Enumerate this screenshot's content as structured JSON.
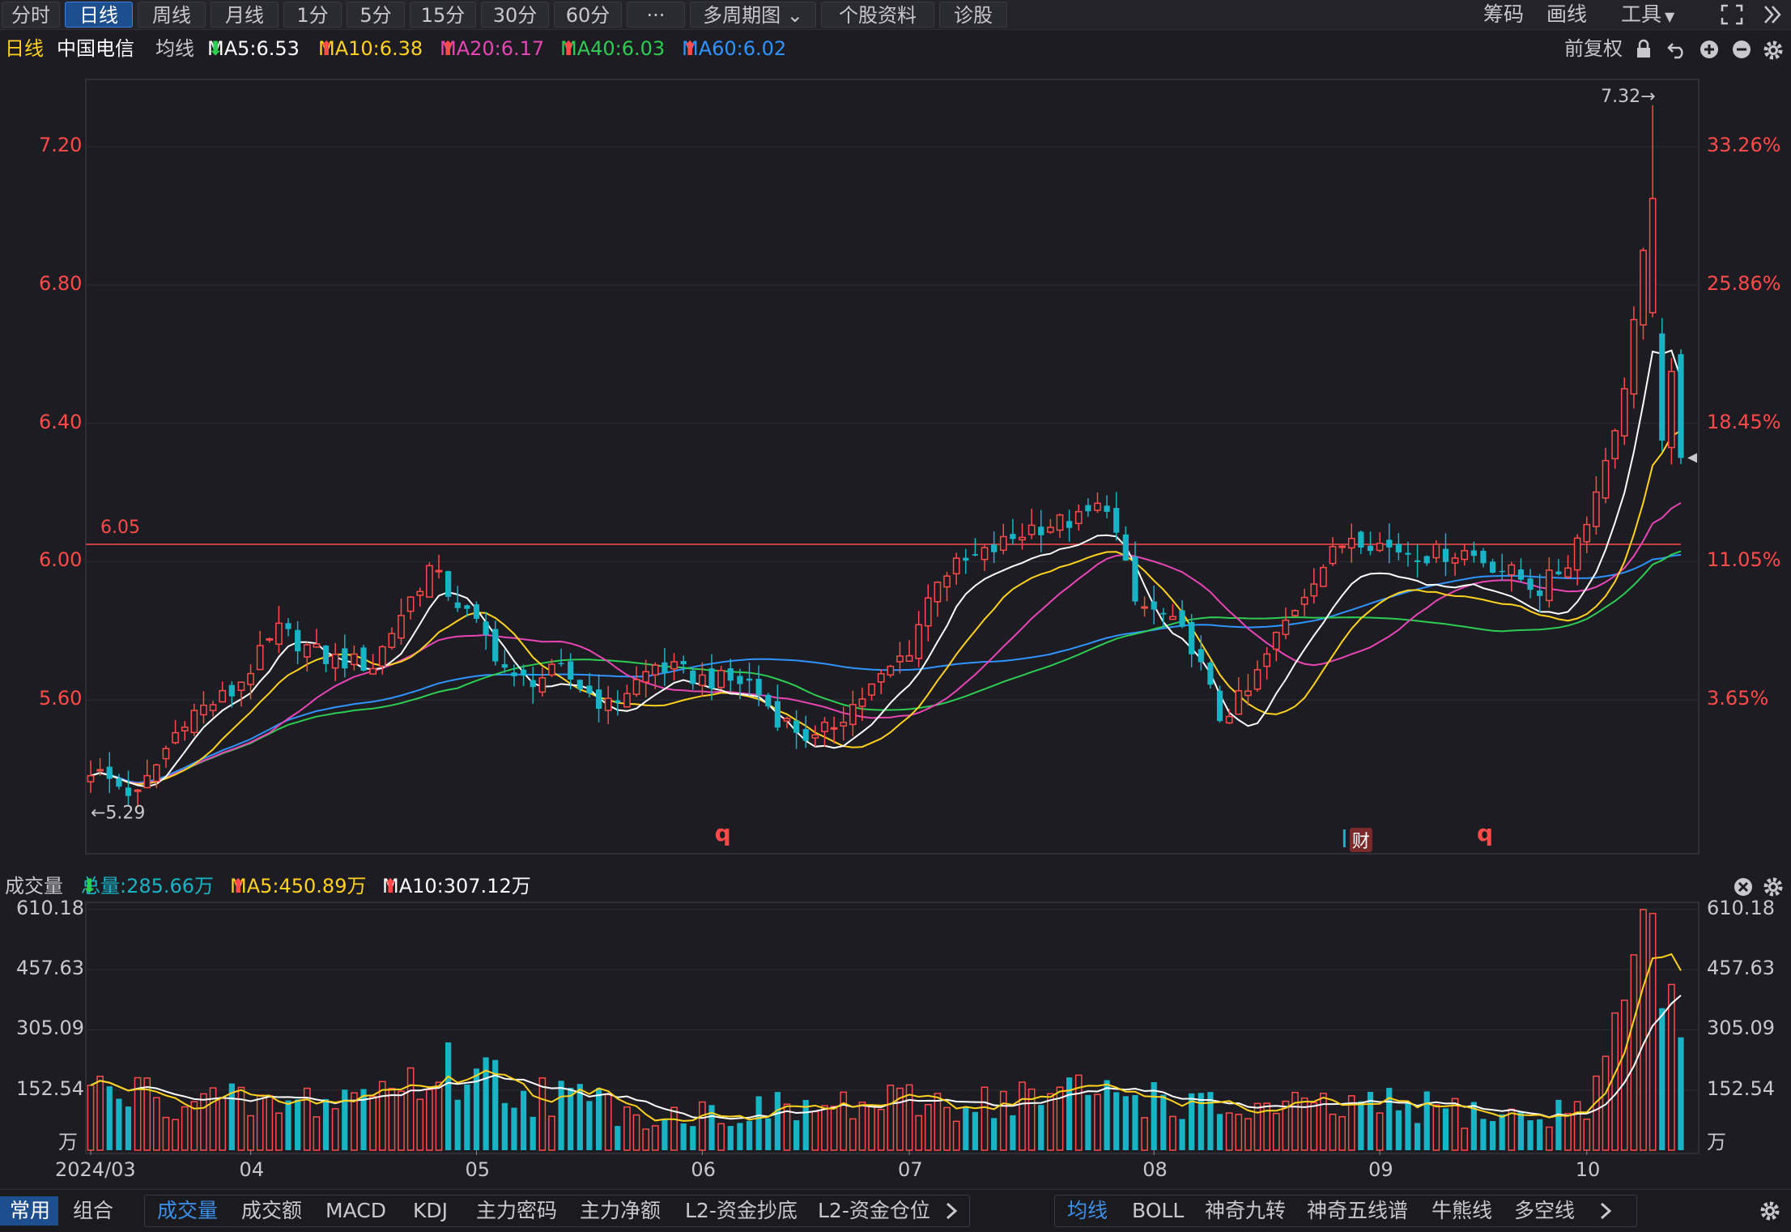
{
  "toolbar": {
    "tabs": [
      "分时",
      "日线",
      "周线",
      "月线",
      "1分",
      "5分",
      "15分",
      "30分",
      "60分",
      "···",
      "多周期图",
      "个股资料",
      "诊股"
    ],
    "active_tab": "日线",
    "right": [
      "筹码",
      "画线",
      "工具"
    ]
  },
  "info": {
    "period": "日线",
    "stock": "中国电信",
    "ma_label": "均线",
    "ma5": "MA5:6.53",
    "ma10": "MA10:6.38",
    "ma20": "MA20:6.17",
    "ma40": "MA40:6.03",
    "ma60": "MA60:6.02",
    "adjust": "前复权"
  },
  "volume_info": {
    "title": "成交量",
    "total": "总量:285.66万",
    "ma5": "MA5:450.89万",
    "ma10": "MA10:307.12万"
  },
  "bottom": {
    "left_tabs": [
      "常用",
      "组合"
    ],
    "indicators": [
      "成交量",
      "成交额",
      "MACD",
      "KDJ",
      "主力密码",
      "主力净额",
      "L2-资金抄底",
      "L2-资金仓位"
    ],
    "overlays": [
      "均线",
      "BOLL",
      "神奇九转",
      "神奇五线谱",
      "牛熊线",
      "多空线"
    ]
  },
  "colors": {
    "up": "#ff4a4a",
    "down": "#19b3c6",
    "ma5": "#ffffff",
    "ma10": "#ffd21e",
    "ma20": "#e845b5",
    "ma40": "#2ecc52",
    "ma60": "#2f94ff",
    "accent": "#3d8fe8"
  },
  "chart_data": {
    "type": "candlestick",
    "price_axis": {
      "ticks": [
        "7.20",
        "6.80",
        "6.40",
        "6.00",
        "5.60"
      ],
      "values": [
        7.2,
        6.8,
        6.4,
        6.0,
        5.6
      ],
      "ylim": [
        5.16,
        7.39
      ]
    },
    "pct_axis": {
      "ticks": [
        "33.26%",
        "25.86%",
        "18.45%",
        "11.05%",
        "3.65%"
      ]
    },
    "reference_line": {
      "label": "6.05",
      "value": 6.05
    },
    "max_label": "7.32→",
    "max_value": 7.32,
    "min_label": "←5.29",
    "min_value": 5.29,
    "x_labels": [
      "2024/03",
      "04",
      "05",
      "06",
      "07",
      "08",
      "09",
      "10"
    ],
    "x_label_index": [
      0,
      17,
      41,
      65,
      87,
      113,
      137,
      159
    ],
    "markers": [
      {
        "text": "q",
        "index": 67
      },
      {
        "text": "财",
        "index": 135
      },
      {
        "text": "q",
        "index": 148
      }
    ],
    "ohlc_keypoints": [
      [
        0,
        5.4
      ],
      [
        5,
        5.32
      ],
      [
        10,
        5.55
      ],
      [
        15,
        5.62
      ],
      [
        20,
        5.8
      ],
      [
        25,
        5.72
      ],
      [
        30,
        5.7
      ],
      [
        33,
        5.85
      ],
      [
        36,
        5.98
      ],
      [
        39,
        5.88
      ],
      [
        42,
        5.78
      ],
      [
        45,
        5.65
      ],
      [
        50,
        5.68
      ],
      [
        55,
        5.58
      ],
      [
        60,
        5.7
      ],
      [
        65,
        5.66
      ],
      [
        70,
        5.65
      ],
      [
        73,
        5.55
      ],
      [
        77,
        5.48
      ],
      [
        80,
        5.56
      ],
      [
        84,
        5.66
      ],
      [
        87,
        5.75
      ],
      [
        90,
        5.96
      ],
      [
        95,
        6.02
      ],
      [
        100,
        6.1
      ],
      [
        105,
        6.12
      ],
      [
        108,
        6.17
      ],
      [
        111,
        5.88
      ],
      [
        114,
        5.84
      ],
      [
        117,
        5.76
      ],
      [
        120,
        5.55
      ],
      [
        123,
        5.62
      ],
      [
        126,
        5.78
      ],
      [
        130,
        5.96
      ],
      [
        134,
        6.08
      ],
      [
        138,
        6.04
      ],
      [
        142,
        6.02
      ],
      [
        146,
        6.03
      ],
      [
        150,
        5.98
      ],
      [
        154,
        5.92
      ],
      [
        157,
        6.0
      ],
      [
        160,
        6.2
      ],
      [
        163,
        6.5
      ],
      [
        165,
        6.9
      ],
      [
        166,
        7.05
      ],
      [
        167,
        6.35
      ],
      [
        168,
        6.55
      ],
      [
        169,
        6.3
      ]
    ],
    "ma_last": {
      "MA5": 6.53,
      "MA10": 6.38,
      "MA20": 6.17,
      "MA40": 6.03,
      "MA60": 6.02
    },
    "volume_axis": {
      "ticks": [
        "610.18",
        "457.63",
        "305.09",
        "152.54"
      ],
      "values": [
        610.18,
        457.63,
        305.09,
        152.54
      ],
      "unit": "万"
    },
    "volume_keypoints": [
      [
        0,
        150
      ],
      [
        20,
        110
      ],
      [
        30,
        150
      ],
      [
        40,
        210
      ],
      [
        45,
        160
      ],
      [
        60,
        90
      ],
      [
        70,
        100
      ],
      [
        80,
        110
      ],
      [
        90,
        120
      ],
      [
        110,
        150
      ],
      [
        120,
        100
      ],
      [
        140,
        110
      ],
      [
        155,
        80
      ],
      [
        160,
        150
      ],
      [
        163,
        380
      ],
      [
        165,
        610
      ],
      [
        166,
        600
      ],
      [
        167,
        360
      ],
      [
        168,
        420
      ],
      [
        169,
        286
      ]
    ]
  }
}
